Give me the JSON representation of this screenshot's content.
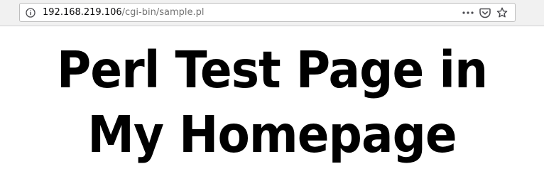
{
  "address_bar": {
    "host": "192.168.219.106",
    "path": "/cgi-bin/sample.pl"
  },
  "icons": {
    "info": "info-icon",
    "more": "more-icon",
    "pocket": "pocket-icon",
    "bookmark": "bookmark-star-icon"
  },
  "page": {
    "heading": "Perl Test Page in My Homepage"
  }
}
